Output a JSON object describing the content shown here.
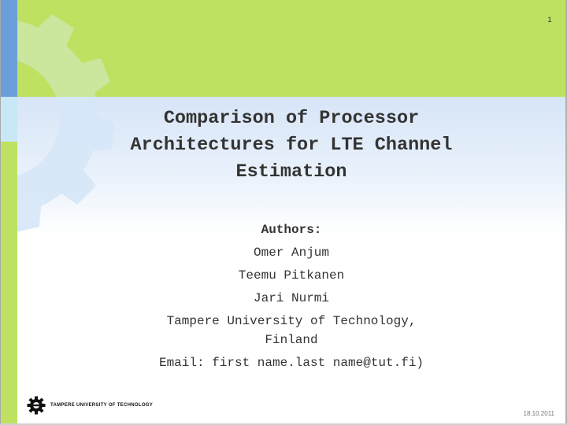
{
  "slide": {
    "number": "1",
    "title_lines": [
      "Comparison of Processor",
      "Architectures for LTE Channel",
      "Estimation"
    ],
    "authors_heading": "Authors:",
    "authors": [
      "Omer Anjum",
      "Teemu Pitkanen",
      "Jari Nurmi"
    ],
    "affiliation_lines": [
      "Tampere University of Technology,",
      "Finland"
    ],
    "email": "Email: first name.last name@tut.fi)",
    "footer": {
      "logo_icon": "gear-icon",
      "logo_text": "TAMPERE UNIVERSITY OF TECHNOLOGY",
      "date": "18.10.2011"
    }
  },
  "colors": {
    "header_green": "#bfe162",
    "strip_blue": "#6b9fdb",
    "strip_cyan": "#c8e7f7",
    "text": "#333333"
  }
}
